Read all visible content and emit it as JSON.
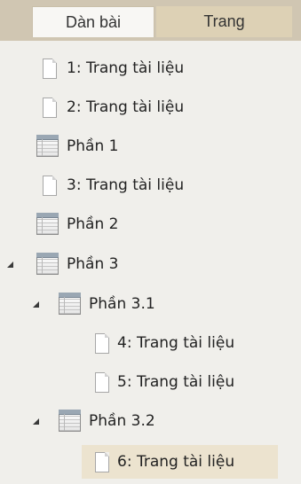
{
  "tabs": {
    "outline_label": "Dàn bài",
    "pages_label": "Trang"
  },
  "tree": {
    "items": [
      {
        "label": "1: Trang tài liệu",
        "type": "page"
      },
      {
        "label": "2: Trang tài liệu",
        "type": "page"
      },
      {
        "label": "Phần 1",
        "type": "section"
      },
      {
        "label": "3: Trang tài liệu",
        "type": "page"
      },
      {
        "label": "Phần 2",
        "type": "section"
      },
      {
        "label": "Phần 3",
        "type": "section",
        "expanded": true
      },
      {
        "label": "Phần 3.1",
        "type": "section",
        "expanded": true
      },
      {
        "label": "4: Trang tài liệu",
        "type": "page"
      },
      {
        "label": "5: Trang tài liệu",
        "type": "page"
      },
      {
        "label": "Phần 3.2",
        "type": "section",
        "expanded": true
      },
      {
        "label": "6: Trang tài liệu",
        "type": "page",
        "selected": true
      }
    ]
  },
  "colors": {
    "tab_bar": "#d0c6b2",
    "panel_background": "#f0efeb",
    "selection": "#ece3cf"
  }
}
